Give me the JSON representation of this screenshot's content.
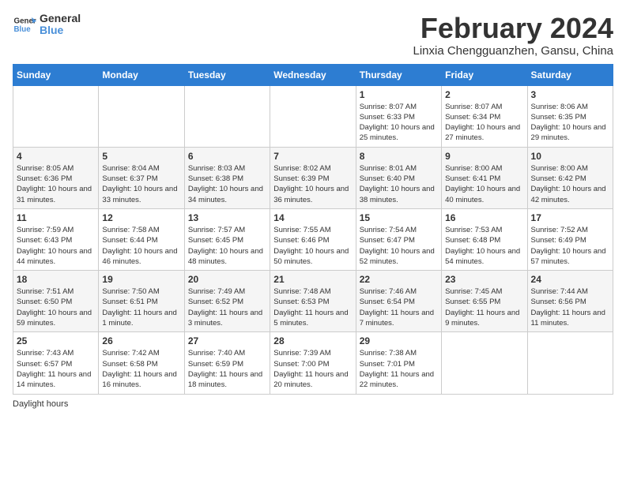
{
  "header": {
    "logo_line1": "General",
    "logo_line2": "Blue",
    "main_title": "February 2024",
    "subtitle": "Linxia Chengguanzhen, Gansu, China"
  },
  "days_of_week": [
    "Sunday",
    "Monday",
    "Tuesday",
    "Wednesday",
    "Thursday",
    "Friday",
    "Saturday"
  ],
  "weeks": [
    [
      {
        "day": "",
        "info": ""
      },
      {
        "day": "",
        "info": ""
      },
      {
        "day": "",
        "info": ""
      },
      {
        "day": "",
        "info": ""
      },
      {
        "day": "1",
        "info": "Sunrise: 8:07 AM\nSunset: 6:33 PM\nDaylight: 10 hours and 25 minutes."
      },
      {
        "day": "2",
        "info": "Sunrise: 8:07 AM\nSunset: 6:34 PM\nDaylight: 10 hours and 27 minutes."
      },
      {
        "day": "3",
        "info": "Sunrise: 8:06 AM\nSunset: 6:35 PM\nDaylight: 10 hours and 29 minutes."
      }
    ],
    [
      {
        "day": "4",
        "info": "Sunrise: 8:05 AM\nSunset: 6:36 PM\nDaylight: 10 hours and 31 minutes."
      },
      {
        "day": "5",
        "info": "Sunrise: 8:04 AM\nSunset: 6:37 PM\nDaylight: 10 hours and 33 minutes."
      },
      {
        "day": "6",
        "info": "Sunrise: 8:03 AM\nSunset: 6:38 PM\nDaylight: 10 hours and 34 minutes."
      },
      {
        "day": "7",
        "info": "Sunrise: 8:02 AM\nSunset: 6:39 PM\nDaylight: 10 hours and 36 minutes."
      },
      {
        "day": "8",
        "info": "Sunrise: 8:01 AM\nSunset: 6:40 PM\nDaylight: 10 hours and 38 minutes."
      },
      {
        "day": "9",
        "info": "Sunrise: 8:00 AM\nSunset: 6:41 PM\nDaylight: 10 hours and 40 minutes."
      },
      {
        "day": "10",
        "info": "Sunrise: 8:00 AM\nSunset: 6:42 PM\nDaylight: 10 hours and 42 minutes."
      }
    ],
    [
      {
        "day": "11",
        "info": "Sunrise: 7:59 AM\nSunset: 6:43 PM\nDaylight: 10 hours and 44 minutes."
      },
      {
        "day": "12",
        "info": "Sunrise: 7:58 AM\nSunset: 6:44 PM\nDaylight: 10 hours and 46 minutes."
      },
      {
        "day": "13",
        "info": "Sunrise: 7:57 AM\nSunset: 6:45 PM\nDaylight: 10 hours and 48 minutes."
      },
      {
        "day": "14",
        "info": "Sunrise: 7:55 AM\nSunset: 6:46 PM\nDaylight: 10 hours and 50 minutes."
      },
      {
        "day": "15",
        "info": "Sunrise: 7:54 AM\nSunset: 6:47 PM\nDaylight: 10 hours and 52 minutes."
      },
      {
        "day": "16",
        "info": "Sunrise: 7:53 AM\nSunset: 6:48 PM\nDaylight: 10 hours and 54 minutes."
      },
      {
        "day": "17",
        "info": "Sunrise: 7:52 AM\nSunset: 6:49 PM\nDaylight: 10 hours and 57 minutes."
      }
    ],
    [
      {
        "day": "18",
        "info": "Sunrise: 7:51 AM\nSunset: 6:50 PM\nDaylight: 10 hours and 59 minutes."
      },
      {
        "day": "19",
        "info": "Sunrise: 7:50 AM\nSunset: 6:51 PM\nDaylight: 11 hours and 1 minute."
      },
      {
        "day": "20",
        "info": "Sunrise: 7:49 AM\nSunset: 6:52 PM\nDaylight: 11 hours and 3 minutes."
      },
      {
        "day": "21",
        "info": "Sunrise: 7:48 AM\nSunset: 6:53 PM\nDaylight: 11 hours and 5 minutes."
      },
      {
        "day": "22",
        "info": "Sunrise: 7:46 AM\nSunset: 6:54 PM\nDaylight: 11 hours and 7 minutes."
      },
      {
        "day": "23",
        "info": "Sunrise: 7:45 AM\nSunset: 6:55 PM\nDaylight: 11 hours and 9 minutes."
      },
      {
        "day": "24",
        "info": "Sunrise: 7:44 AM\nSunset: 6:56 PM\nDaylight: 11 hours and 11 minutes."
      }
    ],
    [
      {
        "day": "25",
        "info": "Sunrise: 7:43 AM\nSunset: 6:57 PM\nDaylight: 11 hours and 14 minutes."
      },
      {
        "day": "26",
        "info": "Sunrise: 7:42 AM\nSunset: 6:58 PM\nDaylight: 11 hours and 16 minutes."
      },
      {
        "day": "27",
        "info": "Sunrise: 7:40 AM\nSunset: 6:59 PM\nDaylight: 11 hours and 18 minutes."
      },
      {
        "day": "28",
        "info": "Sunrise: 7:39 AM\nSunset: 7:00 PM\nDaylight: 11 hours and 20 minutes."
      },
      {
        "day": "29",
        "info": "Sunrise: 7:38 AM\nSunset: 7:01 PM\nDaylight: 11 hours and 22 minutes."
      },
      {
        "day": "",
        "info": ""
      },
      {
        "day": "",
        "info": ""
      }
    ]
  ],
  "footer": {
    "note": "Daylight hours"
  }
}
